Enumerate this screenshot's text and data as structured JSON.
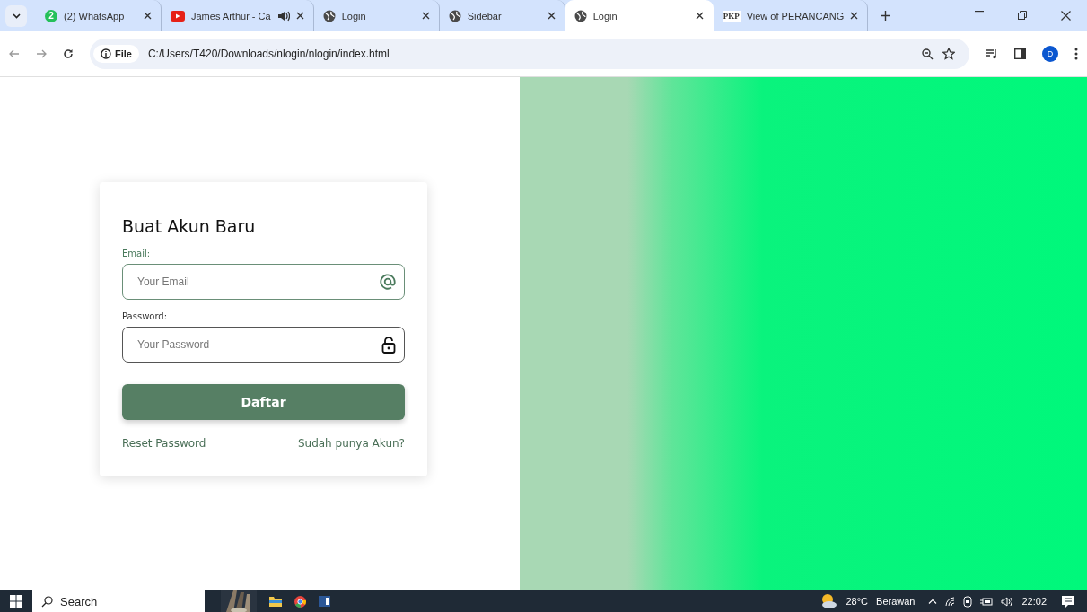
{
  "tabs": [
    {
      "kind": "chat",
      "badge": "2",
      "title": "(2) WhatsApp",
      "audio": false,
      "selected": false
    },
    {
      "kind": "video",
      "title": "James Arthur - Ca",
      "audio": true,
      "selected": false
    },
    {
      "kind": "globe",
      "title": "Login",
      "audio": false,
      "selected": false
    },
    {
      "kind": "globe",
      "title": "Sidebar",
      "audio": false,
      "selected": false
    },
    {
      "kind": "globe",
      "title": "Login",
      "audio": false,
      "selected": true
    },
    {
      "kind": "logo",
      "logo": "PKP",
      "title": "View of PERANCANG",
      "audio": false,
      "selected": false
    }
  ],
  "address_bar": {
    "scheme": "File",
    "url": "C:/Users/T420/Downloads/nlogin/nlogin/index.html"
  },
  "profile": {
    "initial": "D"
  },
  "form": {
    "title": "Buat Akun Baru",
    "fields": [
      {
        "kind": "email",
        "label": "Email:",
        "placeholder": "Your Email"
      },
      {
        "kind": "password",
        "label": "Password:",
        "placeholder": "Your Password"
      }
    ],
    "submit": "Daftar",
    "links": [
      "Reset Password",
      "Sudah punya Akun?"
    ]
  },
  "taskbar": {
    "search": {
      "placeholder": "Search"
    },
    "temperature": "28°C",
    "weather": "Berawan",
    "time": "22:02"
  }
}
